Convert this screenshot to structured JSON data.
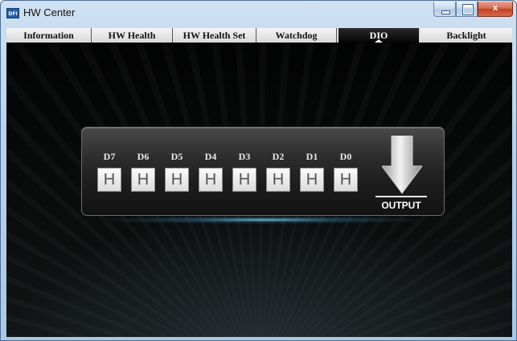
{
  "window": {
    "title": "HW Center",
    "logo_text": "DFI",
    "minimize": "",
    "maximize": "",
    "close": "x"
  },
  "tabs": [
    {
      "label": "Information",
      "active": false
    },
    {
      "label": "HW Health",
      "active": false
    },
    {
      "label": "HW Health Set",
      "active": false
    },
    {
      "label": "Watchdog",
      "active": false
    },
    {
      "label": "DIO",
      "active": true
    },
    {
      "label": "Backlight",
      "active": false
    }
  ],
  "dio": {
    "bits": [
      {
        "label": "D7",
        "value": "H"
      },
      {
        "label": "D6",
        "value": "H"
      },
      {
        "label": "D5",
        "value": "H"
      },
      {
        "label": "D4",
        "value": "H"
      },
      {
        "label": "D3",
        "value": "H"
      },
      {
        "label": "D2",
        "value": "H"
      },
      {
        "label": "D1",
        "value": "H"
      },
      {
        "label": "D0",
        "value": "H"
      }
    ],
    "output_label": "OUTPUT",
    "direction_icon": "down-arrow-icon"
  },
  "colors": {
    "titlebar": "#b8d2ec",
    "client_bg": "#070808",
    "close_button": "#c2401f",
    "glow": "#78d2eb"
  }
}
